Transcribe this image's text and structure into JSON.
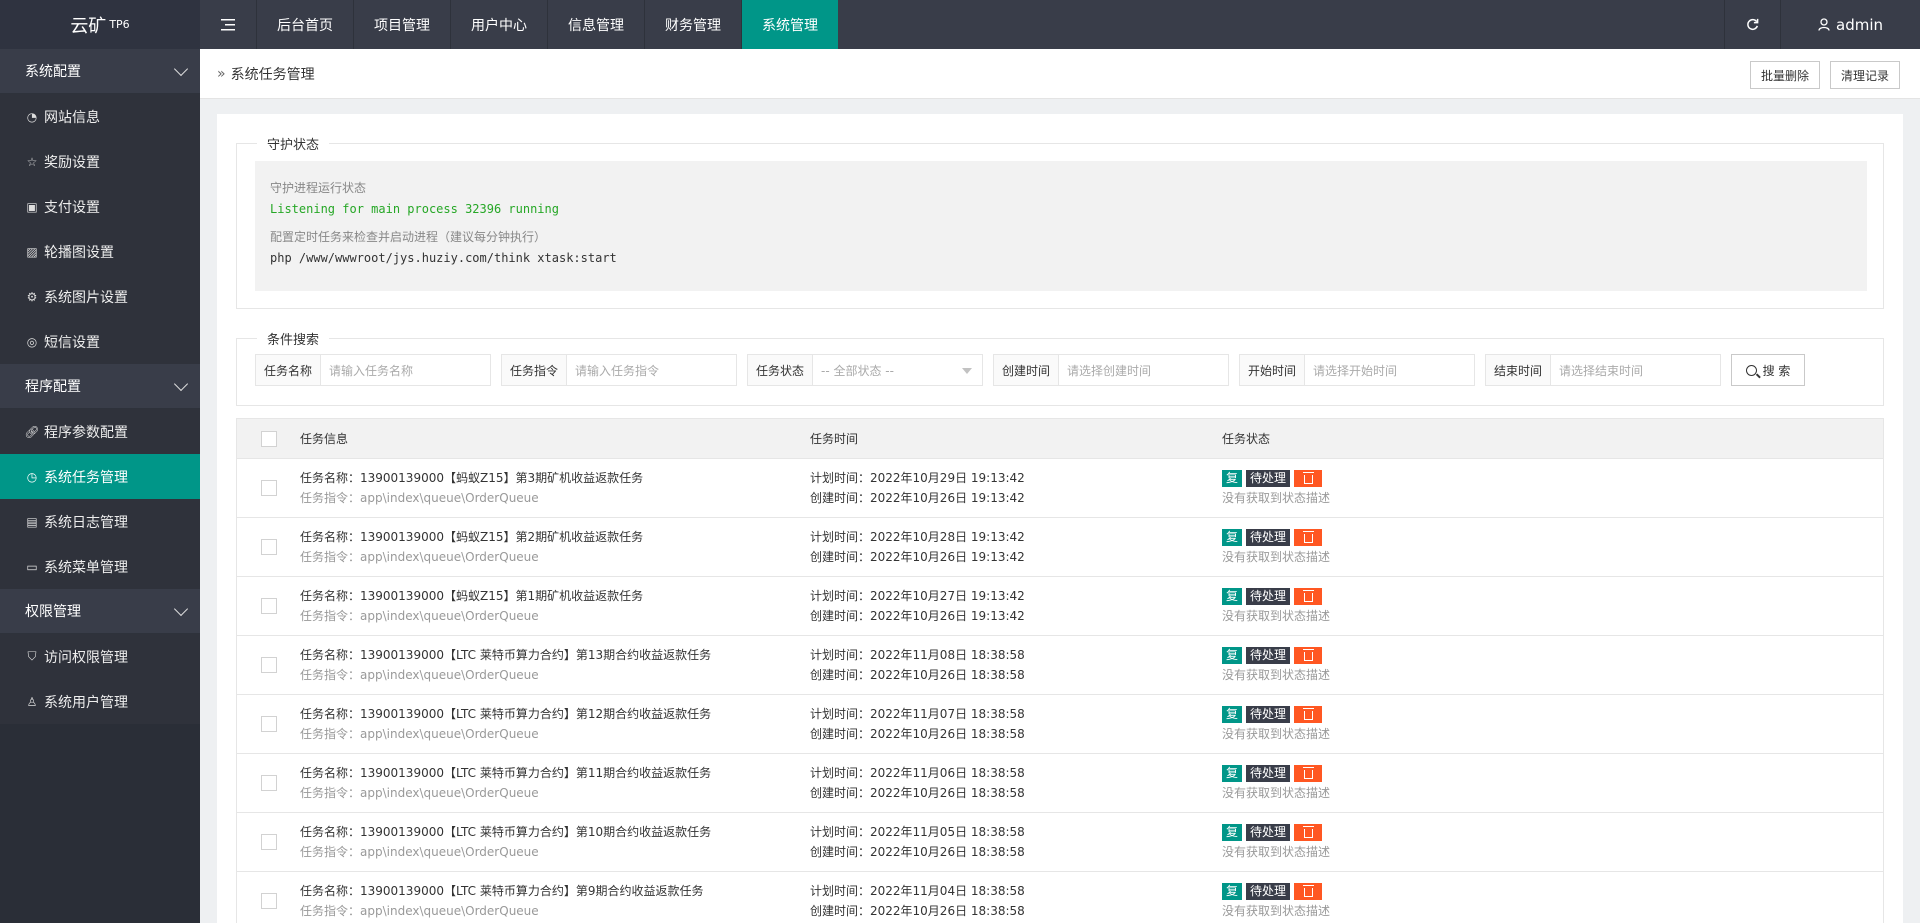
{
  "app": {
    "name": "云矿",
    "badge": "TP6"
  },
  "header": {
    "nav": [
      "后台首页",
      "项目管理",
      "用户中心",
      "信息管理",
      "财务管理",
      "系统管理"
    ],
    "user": "admin"
  },
  "sidebar": {
    "groups": [
      {
        "label": "系统配置",
        "items": [
          "网站信息",
          "奖励设置",
          "支付设置",
          "轮播图设置",
          "系统图片设置",
          "短信设置"
        ]
      },
      {
        "label": "程序配置",
        "items": [
          "程序参数配置",
          "系统任务管理",
          "系统日志管理",
          "系统菜单管理"
        ]
      },
      {
        "label": "权限管理",
        "items": [
          "访问权限管理",
          "系统用户管理"
        ]
      }
    ]
  },
  "breadcrumb": {
    "title": "系统任务管理"
  },
  "actions": {
    "batch_delete": "批量删除",
    "clear_log": "清理记录"
  },
  "guard": {
    "legend": "守护状态",
    "status_label": "守护进程运行状态",
    "status_value": "Listening for main process 32396 running",
    "cron_label": "配置定时任务来检查并启动进程（建议每分钟执行）",
    "cron_cmd": "php /www/wwwroot/jys.huziy.com/think xtask:start"
  },
  "search": {
    "legend": "条件搜索",
    "fields": [
      {
        "label": "任务名称",
        "placeholder": "请输入任务名称"
      },
      {
        "label": "任务指令",
        "placeholder": "请输入任务指令"
      },
      {
        "label": "任务状态",
        "placeholder": "-- 全部状态 --"
      },
      {
        "label": "创建时间",
        "placeholder": "请选择创建时间"
      },
      {
        "label": "开始时间",
        "placeholder": "请选择开始时间"
      },
      {
        "label": "结束时间",
        "placeholder": "请选择结束时间"
      }
    ],
    "button": "搜 索"
  },
  "table": {
    "headers": {
      "info": "任务信息",
      "time": "任务时间",
      "status": "任务状态"
    },
    "tags": {
      "copy": "复",
      "pending": "待处理"
    },
    "rows": [
      {
        "name": "任务名称：13900139000【蚂蚁Z15】第3期矿机收益返款任务",
        "cmd": "任务指令：app\\index\\queue\\OrderQueue",
        "plan": "计划时间：2022年10月29日 19:13:42",
        "created": "创建时间：2022年10月26日 19:13:42",
        "desc": "没有获取到状态描述"
      },
      {
        "name": "任务名称：13900139000【蚂蚁Z15】第2期矿机收益返款任务",
        "cmd": "任务指令：app\\index\\queue\\OrderQueue",
        "plan": "计划时间：2022年10月28日 19:13:42",
        "created": "创建时间：2022年10月26日 19:13:42",
        "desc": "没有获取到状态描述"
      },
      {
        "name": "任务名称：13900139000【蚂蚁Z15】第1期矿机收益返款任务",
        "cmd": "任务指令：app\\index\\queue\\OrderQueue",
        "plan": "计划时间：2022年10月27日 19:13:42",
        "created": "创建时间：2022年10月26日 19:13:42",
        "desc": "没有获取到状态描述"
      },
      {
        "name": "任务名称：13900139000【LTC 莱特币算力合约】第13期合约收益返款任务",
        "cmd": "任务指令：app\\index\\queue\\OrderQueue",
        "plan": "计划时间：2022年11月08日 18:38:58",
        "created": "创建时间：2022年10月26日 18:38:58",
        "desc": "没有获取到状态描述"
      },
      {
        "name": "任务名称：13900139000【LTC 莱特币算力合约】第12期合约收益返款任务",
        "cmd": "任务指令：app\\index\\queue\\OrderQueue",
        "plan": "计划时间：2022年11月07日 18:38:58",
        "created": "创建时间：2022年10月26日 18:38:58",
        "desc": "没有获取到状态描述"
      },
      {
        "name": "任务名称：13900139000【LTC 莱特币算力合约】第11期合约收益返款任务",
        "cmd": "任务指令：app\\index\\queue\\OrderQueue",
        "plan": "计划时间：2022年11月06日 18:38:58",
        "created": "创建时间：2022年10月26日 18:38:58",
        "desc": "没有获取到状态描述"
      },
      {
        "name": "任务名称：13900139000【LTC 莱特币算力合约】第10期合约收益返款任务",
        "cmd": "任务指令：app\\index\\queue\\OrderQueue",
        "plan": "计划时间：2022年11月05日 18:38:58",
        "created": "创建时间：2022年10月26日 18:38:58",
        "desc": "没有获取到状态描述"
      },
      {
        "name": "任务名称：13900139000【LTC 莱特币算力合约】第9期合约收益返款任务",
        "cmd": "任务指令：app\\index\\queue\\OrderQueue",
        "plan": "计划时间：2022年11月04日 18:38:58",
        "created": "创建时间：2022年10月26日 18:38:58",
        "desc": "没有获取到状态描述"
      }
    ]
  }
}
